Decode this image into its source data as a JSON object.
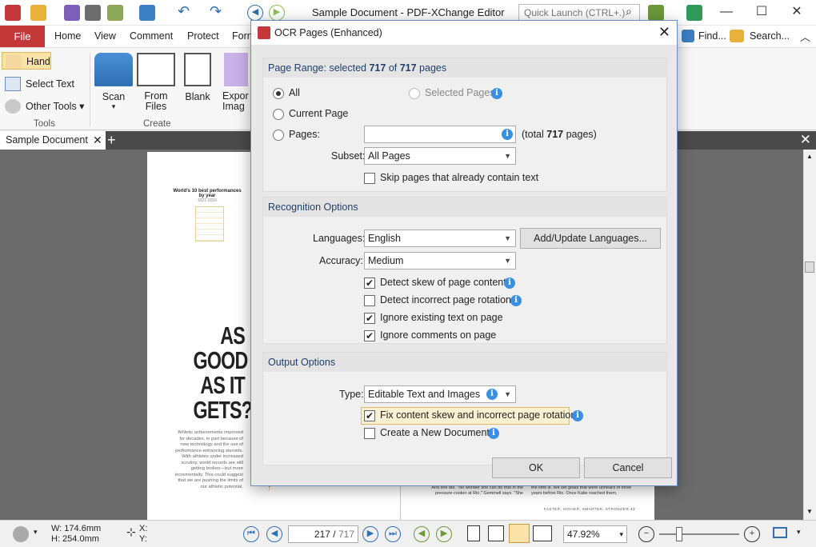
{
  "window": {
    "title": "Sample Document - PDF-XChange Editor",
    "quick_launch_placeholder": "Quick Launch (CTRL+.)",
    "find_label": "Find...",
    "search_label": "Search..."
  },
  "ribbon_tabs": [
    "File",
    "Home",
    "View",
    "Comment",
    "Protect",
    "Form"
  ],
  "ribbon": {
    "hand_label": "Hand",
    "select_text_label": "Select Text",
    "other_tools_label": "Other Tools",
    "tools_group_label": "Tools",
    "scan_label": "Scan",
    "from_files_label": "From\nFiles",
    "blank_label": "Blank",
    "export_label": "Expor\nImag",
    "create_group_label": "Create"
  },
  "document_tab": {
    "label": "Sample Document"
  },
  "page_content": {
    "chart_title": "World's 10 best performances by year",
    "chart_years": "1921-2016",
    "headline": [
      "AS",
      "GOOD",
      "AS IT",
      "GETS?"
    ],
    "body_text": "Athletic achievements improved for decades, in part because of new technology and the use of performance-enhancing steroids. With athletes under increased scrutiny, world records are still getting broken—but more incrementally. This could suggest that we are pushing the limits of our athletic potential.",
    "right_col_text": "And she did. \"No wonder she can do that in the pressure cooker at Rio,\" Gemmell says. \"She",
    "right_col_text2": "the limit is. We set goals that were unheard of three years before Rio. Once Katie reached them,",
    "footer": "FASTER, HIGHER, SMARTER, STRONGER  43"
  },
  "dialog": {
    "title": "OCR Pages (Enhanced)",
    "page_range": {
      "heading_prefix": "Page Range: selected ",
      "selected": "717",
      "of": " of ",
      "total": "717",
      "heading_suffix": " pages",
      "all_label": "All",
      "selected_pages_label": "Selected Pages",
      "current_page_label": "Current Page",
      "pages_label": "Pages:",
      "pages_value": "",
      "total_prefix": "(total ",
      "total_suffix": " pages)",
      "subset_label": "Subset:",
      "subset_value": "All Pages",
      "skip_label": "Skip pages that already contain text",
      "skip_checked": false
    },
    "recognition": {
      "heading": "Recognition Options",
      "languages_label": "Languages:",
      "languages_value": "English",
      "add_languages_button": "Add/Update Languages...",
      "accuracy_label": "Accuracy:",
      "accuracy_value": "Medium",
      "options": [
        {
          "label": "Detect skew of page content",
          "checked": true,
          "info": true
        },
        {
          "label": "Detect incorrect page rotation",
          "checked": false,
          "info": true
        },
        {
          "label": "Ignore existing text on page",
          "checked": true,
          "info": false
        },
        {
          "label": "Ignore comments on page",
          "checked": true,
          "info": false
        }
      ]
    },
    "output": {
      "heading": "Output Options",
      "type_label": "Type:",
      "type_value": "Editable Text and Images",
      "fix_skew_label": "Fix content skew and incorrect page rotation",
      "fix_skew_checked": true,
      "new_doc_label": "Create a New Document",
      "new_doc_checked": false
    },
    "ok_button": "OK",
    "cancel_button": "Cancel"
  },
  "statusbar": {
    "width": "W: 174.6mm",
    "height": "H: 254.0mm",
    "x_label": "X:",
    "y_label": "Y:",
    "current_page": "217",
    "total_pages": "717",
    "zoom": "47.92%"
  },
  "colors": {
    "accent_blue": "#2f6fb3",
    "file_tab_red": "#c4383a",
    "info_blue": "#3b8fe0"
  }
}
